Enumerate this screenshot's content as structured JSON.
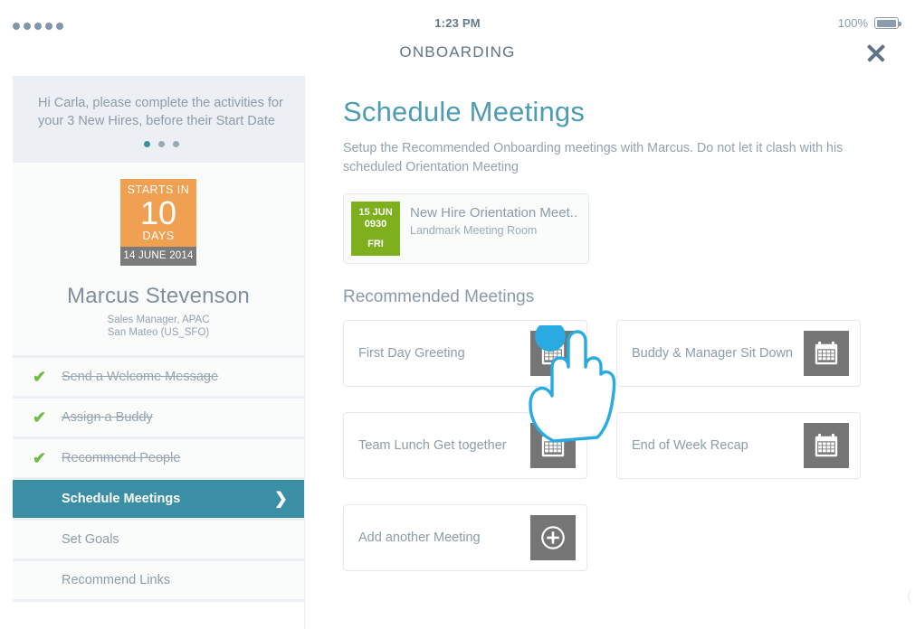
{
  "statusbar": {
    "signal_icon": "signal-dots",
    "time": "1:23 PM",
    "battery_pct": "100%",
    "battery_icon": "battery-full-icon"
  },
  "header": {
    "title": "ONBOARDING",
    "close_icon": "close-icon"
  },
  "sidebar": {
    "greeting": "Hi Carla, please complete the activities for your 3 New Hires, before their Start Date",
    "pager_dots": 3,
    "hire": {
      "starts_label": "STARTS IN",
      "starts_number": "10",
      "starts_unit": "DAYS",
      "start_date": "14 JUNE 2014",
      "name": "Marcus Stevenson",
      "role": "Sales Manager, APAC",
      "location": "San Mateo (US_SFO)"
    },
    "tasks": [
      {
        "label": "Send a Welcome Message",
        "done": true,
        "active": false
      },
      {
        "label": "Assign a Buddy",
        "done": true,
        "active": false
      },
      {
        "label": "Recommend People",
        "done": true,
        "active": false
      },
      {
        "label": "Schedule Meetings",
        "done": false,
        "active": true
      },
      {
        "label": "Set Goals",
        "done": false,
        "active": false
      },
      {
        "label": "Recommend Links",
        "done": false,
        "active": false
      }
    ]
  },
  "content": {
    "title": "Schedule Meetings",
    "subtitle": "Setup the Recommended Onboarding meetings with Marcus. Do not let it clash with his scheduled Orientation Meeting",
    "orientation_meeting": {
      "date": "15 JUN",
      "time": "0930",
      "day": "FRI",
      "name": "New Hire Orientation Meet..",
      "room": "Landmark Meeting Room"
    },
    "recommended_heading": "Recommended Meetings",
    "recommended": [
      {
        "label": "First  Day Greeting",
        "icon": "calendar-icon"
      },
      {
        "label": "Buddy & Manager Sit Down",
        "icon": "calendar-icon"
      },
      {
        "label": "Team Lunch Get together",
        "icon": "calendar-icon"
      },
      {
        "label": "End of Week Recap",
        "icon": "calendar-icon"
      },
      {
        "label": "Add another Meeting",
        "icon": "plus-circle-icon"
      }
    ]
  },
  "gesture": {
    "icon": "tap-hand-icon"
  },
  "colors": {
    "accent_teal": "#3a8fa4",
    "title_blue": "#4e9cb3",
    "orange": "#efa051",
    "green": "#7eaf1d",
    "check_green": "#6fbd44",
    "icon_grey": "#757575",
    "tap_cyan": "#29abe2"
  }
}
